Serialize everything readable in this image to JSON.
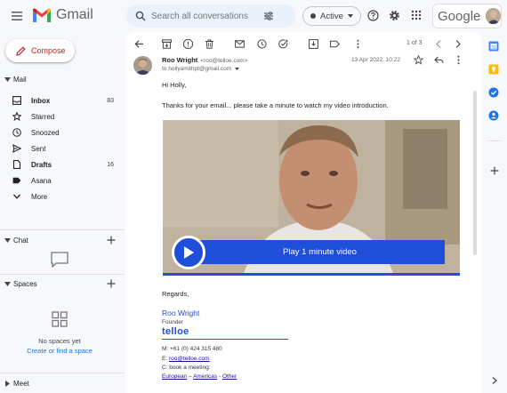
{
  "app": {
    "name": "Gmail"
  },
  "search": {
    "placeholder": "Search all conversations"
  },
  "status": {
    "label": "Active"
  },
  "account": {
    "brand": "Google"
  },
  "sidebar": {
    "compose_label": "Compose",
    "mail_header": "Mail",
    "items": [
      {
        "label": "Inbox",
        "count": "83",
        "bold": true,
        "icon": "inbox-icon"
      },
      {
        "label": "Starred",
        "count": "",
        "bold": false,
        "icon": "star-icon"
      },
      {
        "label": "Snoozed",
        "count": "",
        "bold": false,
        "icon": "clock-icon"
      },
      {
        "label": "Sent",
        "count": "",
        "bold": false,
        "icon": "send-icon"
      },
      {
        "label": "Drafts",
        "count": "16",
        "bold": true,
        "icon": "file-icon"
      },
      {
        "label": "Asana",
        "count": "",
        "bold": false,
        "icon": "label-icon"
      },
      {
        "label": "More",
        "count": "",
        "bold": false,
        "icon": "chevron-down-icon"
      }
    ],
    "chat_header": "Chat",
    "spaces_header": "Spaces",
    "no_spaces_text": "No spaces yet",
    "create_space_link": "Create or find a space",
    "meet_header": "Meet"
  },
  "toolbar": {
    "pagination": "1 of 3"
  },
  "email": {
    "sender_name": "Roo Wright",
    "sender_email": "<roo@telloe.com>",
    "to_line": "to hollyamithpt@gmail.com",
    "date": "13 Apr 2022, 10:22",
    "greeting": "Hi Holly,",
    "intro": "Thanks for your email... please take a minute to watch my video introduction.",
    "video_cta": "Play 1 minute video",
    "regards": "Regards,",
    "sig_name": "Roo Wright",
    "sig_title": "Founder",
    "sig_company": "telloe",
    "sig_mobile": "M: +61 (0) 424 315 480",
    "sig_email_prefix": "E: ",
    "sig_email": "roo@telloe.com",
    "sig_book": "C: book a meeting:",
    "sig_region_1": "European",
    "sig_sep_1": " – ",
    "sig_region_2": "Americas",
    "sig_sep_2": " - ",
    "sig_region_3": "Other"
  },
  "colors": {
    "accent_blue": "#1f4ed8",
    "gmail_red": "#c5221f",
    "bg": "#f6f8fc"
  }
}
